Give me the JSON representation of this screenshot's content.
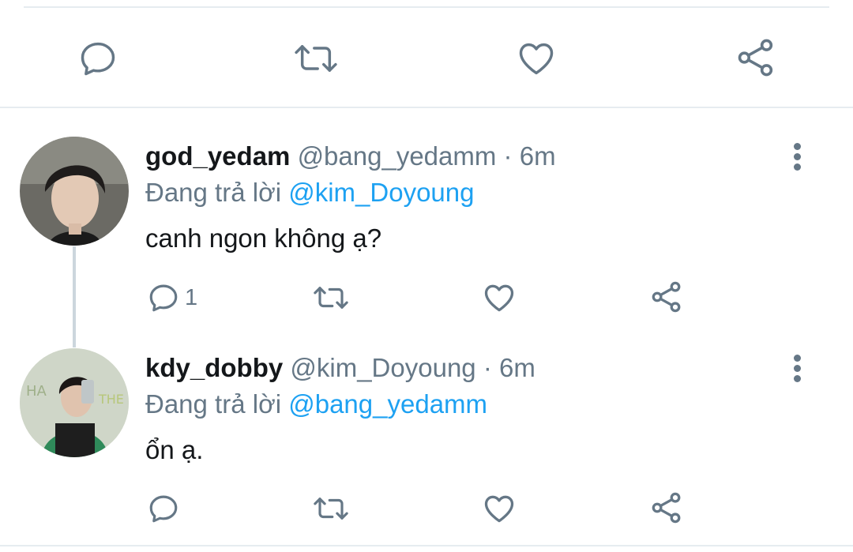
{
  "top_actions": [
    "reply-icon",
    "retweet-icon",
    "like-icon",
    "share-icon"
  ],
  "replies": [
    {
      "display_name": "god_yedam",
      "handle": "@bang_yedamm",
      "separator": "·",
      "time": "6m",
      "replying_prefix": "Đang trả lời",
      "replying_to": "@kim_Doyoung",
      "text": "canh ngon không ạ?",
      "reply_count": "1"
    },
    {
      "display_name": "kdy_dobby",
      "handle": "@kim_Doyoung",
      "separator": "·",
      "time": "6m",
      "replying_prefix": "Đang trả lời",
      "replying_to": "@bang_yedamm",
      "text": "ổn ạ.",
      "reply_count": ""
    }
  ],
  "colors": {
    "icon": "#657786",
    "mention": "#1da1f2",
    "divider": "#e6ecf0",
    "thread_line": "#ccd6dd"
  }
}
